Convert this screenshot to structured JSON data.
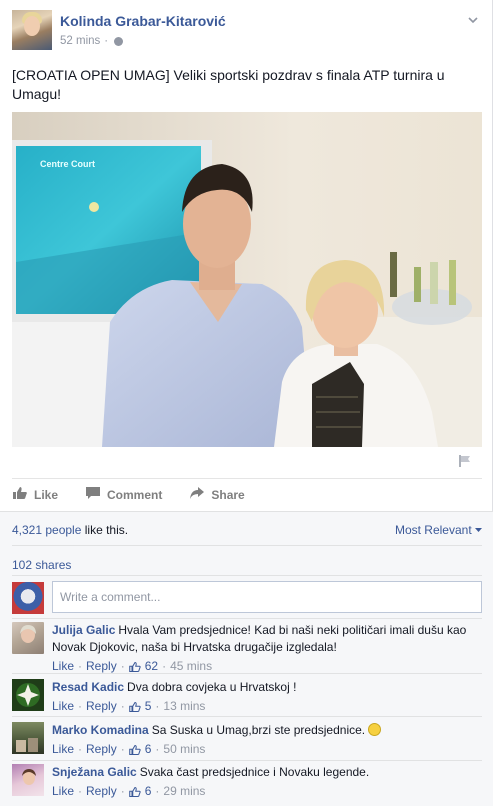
{
  "post": {
    "author": "Kolinda Grabar-Kitarović",
    "time": "52 mins",
    "separator": "·",
    "text": "[CROATIA OPEN UMAG] Veliki sportski pozdrav s finala ATP turnira u Umagu!",
    "photo_screen_text": "Centre Court"
  },
  "actions": {
    "like": "Like",
    "comment": "Comment",
    "share": "Share"
  },
  "ufi": {
    "likes_count": "4,321 people",
    "likes_suffix": " like this.",
    "sort_label": "Most Relevant",
    "shares": "102 shares",
    "composer_placeholder": "Write a comment..."
  },
  "comments": [
    {
      "name": "Julija Galic",
      "text": "Hvala Vam predsjednice! Kad bi naši neki političari imali dušu kao Novak Djokovic, naša bi Hrvatska drugačije izgledala!",
      "like": "Like",
      "reply": "Reply",
      "likes": "62",
      "time": "45 mins"
    },
    {
      "name": "Resad Kadic",
      "text": "Dva dobra covjeka u Hrvatskoj !",
      "like": "Like",
      "reply": "Reply",
      "likes": "5",
      "time": "13 mins"
    },
    {
      "name": "Marko Komadina",
      "text": "Sa Suska u Umag,brzi ste predsjednice.",
      "like": "Like",
      "reply": "Reply",
      "likes": "6",
      "time": "50 mins"
    },
    {
      "name": "Snježana Galic",
      "text": "Svaka čast predsjednice i Novaku legende.",
      "like": "Like",
      "reply": "Reply",
      "likes": "6",
      "time": "29 mins"
    }
  ],
  "colors": {
    "link": "#3b5998",
    "muted": "#9197a3",
    "ufi_background": "#f6f7f9"
  }
}
